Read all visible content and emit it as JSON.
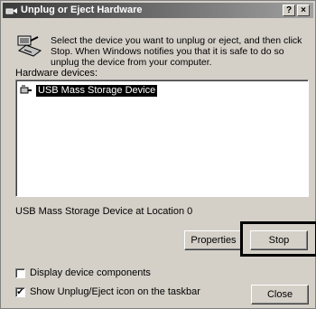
{
  "window": {
    "title": "Unplug or Eject Hardware",
    "help_label": "?",
    "close_label": "×"
  },
  "intro": {
    "text": "Select the device you want to unplug or eject, and then click Stop. When Windows notifies you that it is safe to do so unplug the device from your computer."
  },
  "devices": {
    "label": "Hardware devices:",
    "items": [
      {
        "label": "USB Mass Storage Device",
        "selected": true
      }
    ]
  },
  "location_text": "USB Mass Storage Device at Location 0",
  "buttons": {
    "properties": "Properties",
    "stop": "Stop",
    "close": "Close"
  },
  "options": {
    "display_components": {
      "label": "Display device components",
      "checked": false
    },
    "show_icon": {
      "label": "Show Unplug/Eject icon on the taskbar",
      "checked": true,
      "mark": "✔"
    }
  }
}
